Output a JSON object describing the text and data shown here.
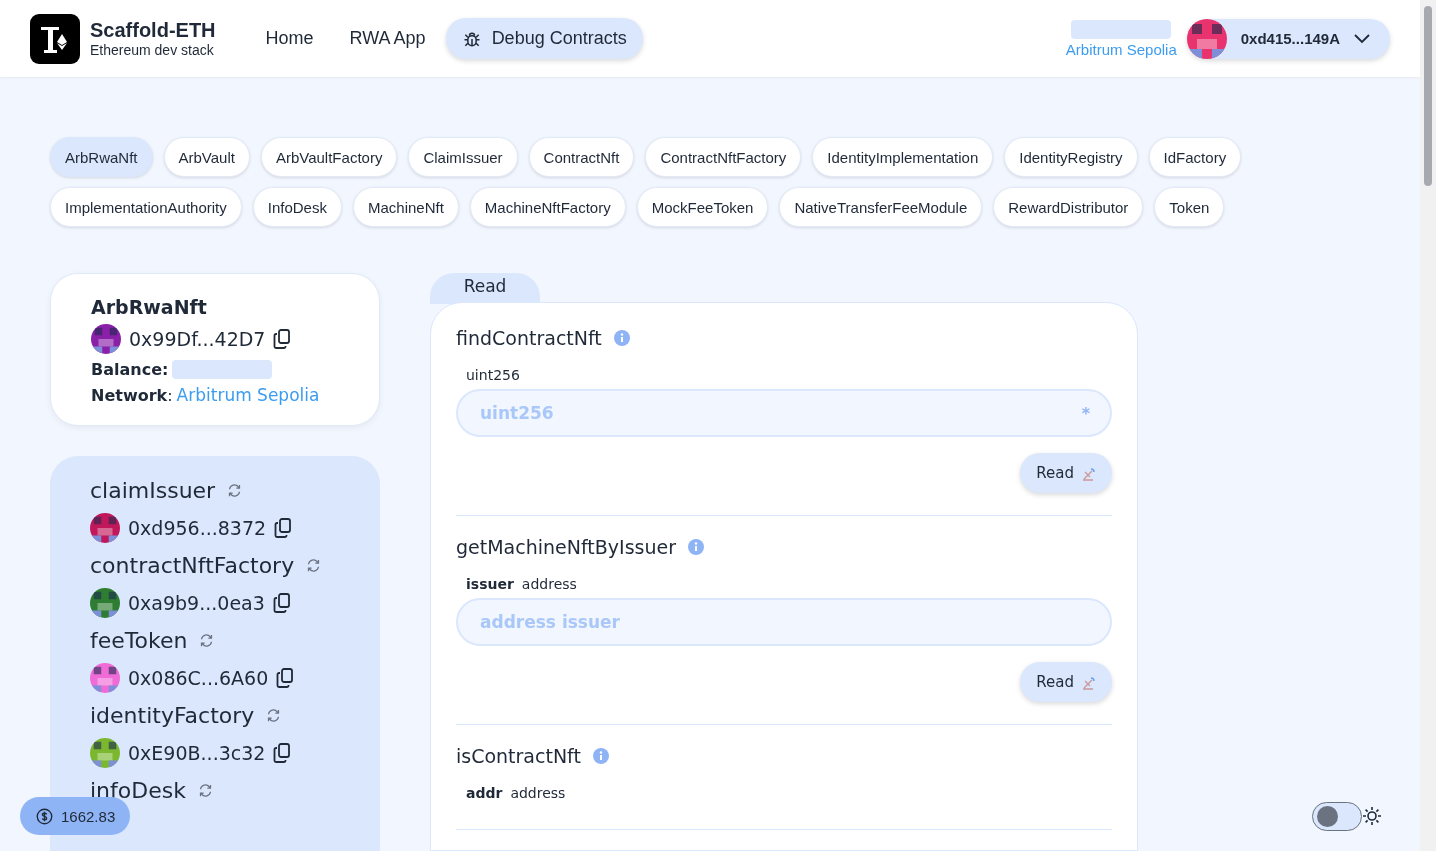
{
  "brand": {
    "title": "Scaffold-ETH",
    "subtitle": "Ethereum dev stack"
  },
  "nav": [
    {
      "label": "Home",
      "selected": false
    },
    {
      "label": "RWA App",
      "selected": false
    },
    {
      "label": "Debug Contracts",
      "selected": true
    }
  ],
  "network": {
    "name": "Arbitrum Sepolia"
  },
  "account": {
    "address": "0xd415...149A",
    "color": "#e8336f"
  },
  "contracts": [
    {
      "label": "ArbRwaNft",
      "selected": true
    },
    {
      "label": "ArbVault",
      "selected": false
    },
    {
      "label": "ArbVaultFactory",
      "selected": false
    },
    {
      "label": "ClaimIssuer",
      "selected": false
    },
    {
      "label": "ContractNft",
      "selected": false
    },
    {
      "label": "ContractNftFactory",
      "selected": false
    },
    {
      "label": "IdentityImplementation",
      "selected": false
    },
    {
      "label": "IdentityRegistry",
      "selected": false
    },
    {
      "label": "IdFactory",
      "selected": false
    },
    {
      "label": "ImplementationAuthority",
      "selected": false
    },
    {
      "label": "InfoDesk",
      "selected": false
    },
    {
      "label": "MachineNft",
      "selected": false
    },
    {
      "label": "MachineNftFactory",
      "selected": false
    },
    {
      "label": "MockFeeToken",
      "selected": false
    },
    {
      "label": "NativeTransferFeeModule",
      "selected": false
    },
    {
      "label": "RewardDistributor",
      "selected": false
    },
    {
      "label": "Token",
      "selected": false
    }
  ],
  "contract_card": {
    "name": "ArbRwaNft",
    "address": "0x99Df...42D7",
    "color": "#8a1fa8",
    "balance_label": "Balance:",
    "network_label": "**Network**:",
    "network": "Arbitrum Sepolia"
  },
  "variables": [
    {
      "name": "claimIssuer",
      "address": "0xd956...8372",
      "color": "#c2185b"
    },
    {
      "name": "contractNftFactory",
      "address": "0xa9b9...0ea3",
      "color": "#2e7d32"
    },
    {
      "name": "feeToken",
      "address": "0x086C...6A60",
      "color": "#f06bd8"
    },
    {
      "name": "identityFactory",
      "address": "0xE90B...3c32",
      "color": "#7cb82f"
    },
    {
      "name": "infoDesk"
    }
  ],
  "tabs": [
    {
      "label": "Read",
      "selected": true
    }
  ],
  "functions": [
    {
      "name": "findContractNft",
      "inputs": [
        {
          "type": "uint256",
          "placeholder": "uint256",
          "marker": "*"
        }
      ],
      "button": "Read"
    },
    {
      "name": "getMachineNftByIssuer",
      "inputs": [
        {
          "name": "issuer",
          "type": "address",
          "placeholder": "address issuer"
        }
      ],
      "button": "Read"
    },
    {
      "name": "isContractNft",
      "inputs": [
        {
          "name": "addr",
          "type": "address"
        }
      ]
    }
  ],
  "price": {
    "value": "1662.83"
  },
  "theme_toggle": {
    "on": false
  }
}
